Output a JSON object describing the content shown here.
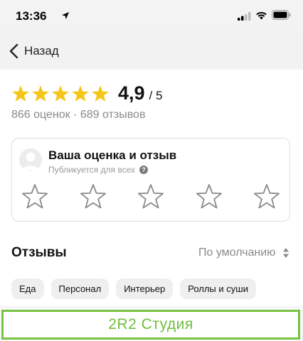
{
  "status_bar": {
    "time": "13:36",
    "icons": [
      "location-arrow-icon",
      "signal-icon",
      "wifi-icon",
      "battery-icon"
    ]
  },
  "nav": {
    "back_label": "Назад",
    "back_icon": "chevron-left-icon"
  },
  "rating": {
    "value": "4,9",
    "max": "/ 5",
    "stars_filled": 5,
    "star_color": "#f5c518",
    "counts": "866 оценок · 689 отзывов"
  },
  "review_card": {
    "title": "Ваша оценка и отзыв",
    "subtitle": "Публикуется для всех",
    "help_symbol": "?",
    "empty_stars": 5
  },
  "reviews": {
    "heading": "Отзывы",
    "sort_label": "По умолчанию",
    "chips": [
      "Еда",
      "Персонал",
      "Интерьер",
      "Роллы и суши"
    ]
  },
  "watermark": {
    "text": "2R2 Студия",
    "color": "#6fbe3c"
  }
}
